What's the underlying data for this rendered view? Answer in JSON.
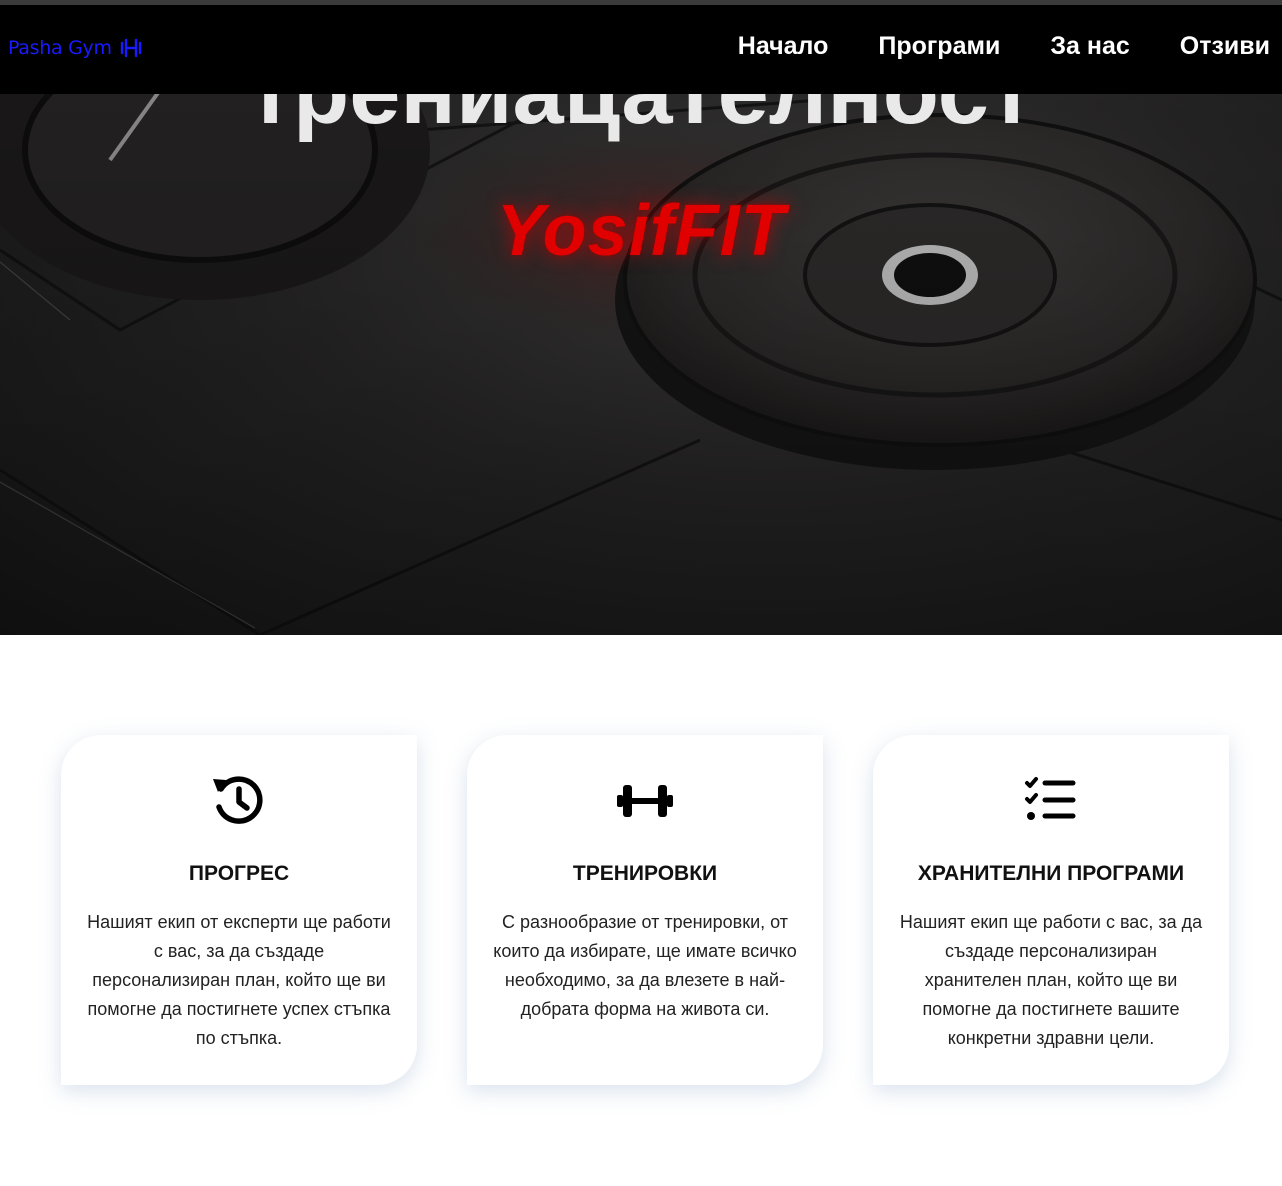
{
  "navbar": {
    "logo_text": "Pasha Gym",
    "logo_icon": "dumbbell-icon",
    "links": [
      "Начало",
      "Програми",
      "За нас",
      "Отзиви"
    ]
  },
  "hero": {
    "heading": "трениацателност",
    "brand": "YosifFIT",
    "brand_color": "#e00000"
  },
  "features": [
    {
      "icon": "history-icon",
      "title": "ПРОГРЕС",
      "text": "Нашият екип от експерти ще работи с вас, за да създаде персонализиран план, който ще ви помогне да постигнете успех стъпка по стъпка."
    },
    {
      "icon": "dumbbell-icon",
      "title": "ТРЕНИРОВКИ",
      "text": "С разнообразие от тренировки, от които да избирате, ще имате всичко необходимо, за да влезете в най-добрата форма на живота си."
    },
    {
      "icon": "checklist-icon",
      "title": "ХРАНИТЕЛНИ ПРОГРАМИ",
      "text": "Нашият екип ще работи с вас, за да създаде персонализиран хранителен план, който ще ви помогне да постигнете вашите конкретни здравни цели."
    }
  ],
  "colors": {
    "navbar_bg": "#000000",
    "logo": "#1a1aff",
    "accent_red": "#e00000"
  }
}
